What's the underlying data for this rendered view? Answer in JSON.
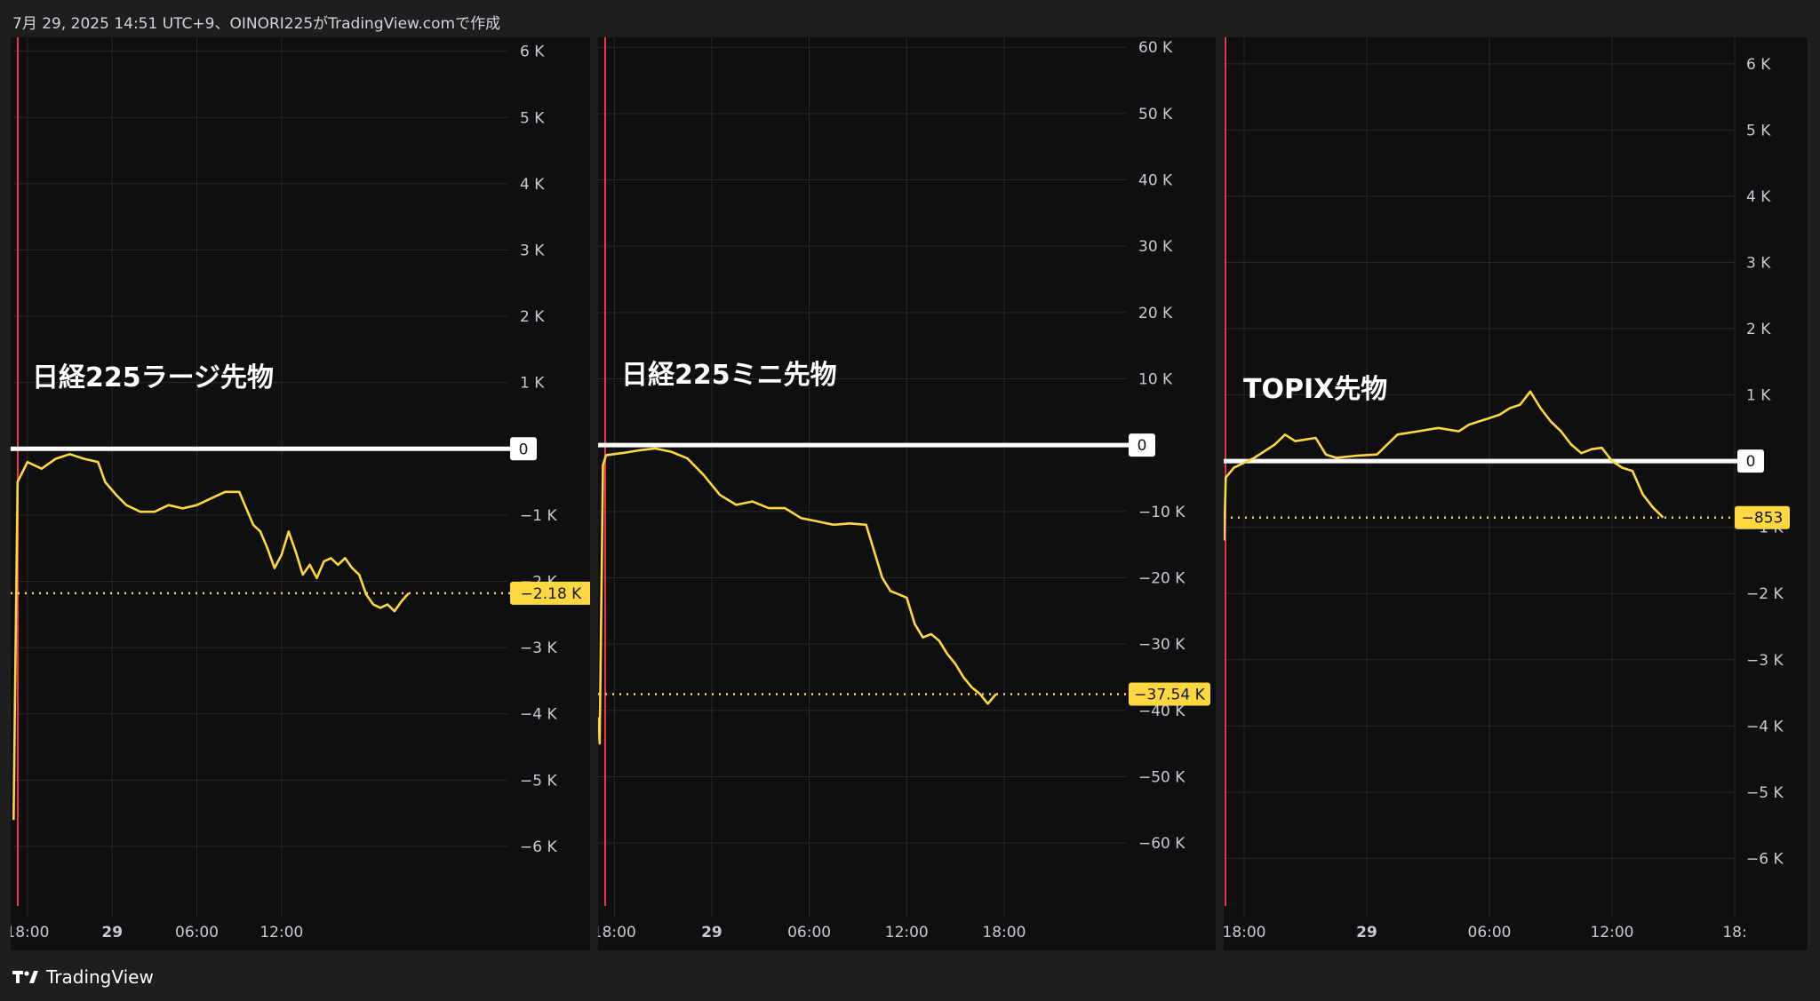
{
  "header": {
    "text": "7月 29, 2025 14:51 UTC+9、OINORI225がTradingView.comで作成"
  },
  "footer": {
    "brand": "TradingView",
    "logo_icon": "tradingview-logo-icon"
  },
  "colors": {
    "background": "#1e1e1e",
    "panel": "#0f0f0f",
    "series": "#ffd740",
    "zero_line": "#ffffff",
    "session_marker": "#f23645",
    "grid": "#2a2a2a"
  },
  "chart_data": [
    {
      "type": "line",
      "title": "日経225ラージ先物",
      "y_ticks": [
        6000,
        5000,
        4000,
        3000,
        2000,
        1000,
        0,
        -1000,
        -2000,
        -3000,
        -4000,
        -5000,
        -6000
      ],
      "y_tick_labels": [
        "6 K",
        "5 K",
        "4 K",
        "3 K",
        "2 K",
        "1 K",
        "",
        "−1 K",
        "−2 K",
        "−3 K",
        "−4 K",
        "−5 K",
        "−6 K"
      ],
      "ylim": [
        -7060,
        6210
      ],
      "x_ticks": [
        {
          "x": 0.5,
          "label": "18:00",
          "bold": false
        },
        {
          "x": 6.5,
          "label": "29",
          "bold": true
        },
        {
          "x": 12.5,
          "label": "06:00",
          "bold": false
        },
        {
          "x": 18.5,
          "label": "12:00",
          "bold": false
        }
      ],
      "xlim": [
        -0.5,
        34.5
      ],
      "zero_label": "0",
      "last_value": -2180,
      "last_label": "−2.18 K",
      "series": [
        {
          "values": [
            [
              -0.48,
              -5600
            ],
            [
              -0.35,
              -3200
            ],
            [
              -0.2,
              -500
            ],
            [
              0.5,
              -200
            ],
            [
              1.5,
              -300
            ],
            [
              2.5,
              -150
            ],
            [
              3.5,
              -80
            ],
            [
              4.5,
              -150
            ],
            [
              5.5,
              -200
            ],
            [
              6.0,
              -500
            ],
            [
              6.8,
              -700
            ],
            [
              7.5,
              -850
            ],
            [
              8.5,
              -950
            ],
            [
              9.5,
              -950
            ],
            [
              10.5,
              -850
            ],
            [
              11.5,
              -900
            ],
            [
              12.5,
              -850
            ],
            [
              13.5,
              -750
            ],
            [
              14.5,
              -650
            ],
            [
              15.5,
              -650
            ],
            [
              16.0,
              -900
            ],
            [
              16.5,
              -1150
            ],
            [
              17.0,
              -1250
            ],
            [
              17.5,
              -1500
            ],
            [
              18.0,
              -1800
            ],
            [
              18.5,
              -1600
            ],
            [
              19.0,
              -1250
            ],
            [
              19.5,
              -1550
            ],
            [
              20.0,
              -1900
            ],
            [
              20.5,
              -1750
            ],
            [
              21.0,
              -1950
            ],
            [
              21.5,
              -1700
            ],
            [
              22.0,
              -1650
            ],
            [
              22.5,
              -1750
            ],
            [
              23.0,
              -1650
            ],
            [
              23.5,
              -1800
            ],
            [
              24.0,
              -1900
            ],
            [
              24.5,
              -2200
            ],
            [
              25.0,
              -2350
            ],
            [
              25.5,
              -2400
            ],
            [
              26.0,
              -2350
            ],
            [
              26.5,
              -2450
            ],
            [
              27.0,
              -2300
            ],
            [
              27.5,
              -2180
            ]
          ]
        }
      ]
    },
    {
      "type": "line",
      "title": "日経225ミニ先物",
      "y_ticks": [
        60000,
        50000,
        40000,
        30000,
        20000,
        10000,
        0,
        -10000,
        -20000,
        -30000,
        -40000,
        -50000,
        -60000
      ],
      "y_tick_labels": [
        "60 K",
        "50 K",
        "40 K",
        "30 K",
        "20 K",
        "10 K",
        "",
        "−10 K",
        "−20 K",
        "−30 K",
        "−40 K",
        "−50 K",
        "−60 K"
      ],
      "ylim": [
        -71100,
        61500
      ],
      "x_ticks": [
        {
          "x": 0.5,
          "label": "18:00",
          "bold": false
        },
        {
          "x": 6.5,
          "label": "29",
          "bold": true
        },
        {
          "x": 12.5,
          "label": "06:00",
          "bold": false
        },
        {
          "x": 18.5,
          "label": "12:00",
          "bold": false
        },
        {
          "x": 24.5,
          "label": "18:00",
          "bold": false
        }
      ],
      "xlim": [
        -0.5,
        32.0
      ],
      "zero_label": "0",
      "last_value": -37540,
      "last_label": "−37.54 K",
      "series": [
        {
          "values": [
            [
              -0.47,
              -41000
            ],
            [
              -0.4,
              -45000
            ],
            [
              -0.2,
              -3000
            ],
            [
              0.0,
              -1500
            ],
            [
              1.0,
              -1200
            ],
            [
              2.0,
              -800
            ],
            [
              3.0,
              -500
            ],
            [
              4.0,
              -1000
            ],
            [
              5.0,
              -2000
            ],
            [
              6.0,
              -4500
            ],
            [
              7.0,
              -7500
            ],
            [
              8.0,
              -9000
            ],
            [
              9.0,
              -8500
            ],
            [
              10.0,
              -9500
            ],
            [
              11.0,
              -9500
            ],
            [
              12.0,
              -11000
            ],
            [
              13.0,
              -11500
            ],
            [
              14.0,
              -12000
            ],
            [
              15.0,
              -11800
            ],
            [
              16.0,
              -12000
            ],
            [
              16.5,
              -16000
            ],
            [
              17.0,
              -20000
            ],
            [
              17.5,
              -22000
            ],
            [
              18.0,
              -22500
            ],
            [
              18.5,
              -23000
            ],
            [
              19.0,
              -27000
            ],
            [
              19.5,
              -29000
            ],
            [
              20.0,
              -28500
            ],
            [
              20.5,
              -29500
            ],
            [
              21.0,
              -31500
            ],
            [
              21.5,
              -33000
            ],
            [
              22.0,
              -35000
            ],
            [
              22.5,
              -36500
            ],
            [
              23.0,
              -37500
            ],
            [
              23.5,
              -39000
            ],
            [
              24.0,
              -37540
            ]
          ]
        }
      ]
    },
    {
      "type": "line",
      "title": "TOPIX先物",
      "y_ticks": [
        6000,
        5000,
        4000,
        3000,
        2000,
        1000,
        0,
        -1000,
        -2000,
        -3000,
        -4000,
        -5000,
        -6000
      ],
      "y_tick_labels": [
        "6 K",
        "5 K",
        "4 K",
        "3 K",
        "2 K",
        "1 K",
        "",
        "−1 K",
        "−2 K",
        "−3 K",
        "−4 K",
        "−5 K",
        "−6 K"
      ],
      "ylim": [
        -6880,
        6400
      ],
      "x_ticks": [
        {
          "x": 0.5,
          "label": "18:00",
          "bold": false
        },
        {
          "x": 6.5,
          "label": "29",
          "bold": true
        },
        {
          "x": 12.5,
          "label": "06:00",
          "bold": false
        },
        {
          "x": 18.5,
          "label": "12:00",
          "bold": false
        },
        {
          "x": 24.5,
          "label": "18:",
          "bold": false
        }
      ],
      "xlim": [
        -0.5,
        24.5
      ],
      "zero_label": "0",
      "last_value": -853,
      "last_label": "−853",
      "series": [
        {
          "values": [
            [
              -0.48,
              -1200
            ],
            [
              -0.4,
              -250
            ],
            [
              0.0,
              -100
            ],
            [
              1.0,
              50
            ],
            [
              2.0,
              250
            ],
            [
              2.5,
              400
            ],
            [
              3.0,
              300
            ],
            [
              4.0,
              350
            ],
            [
              4.5,
              100
            ],
            [
              5.0,
              50
            ],
            [
              6.0,
              80
            ],
            [
              7.0,
              100
            ],
            [
              7.5,
              250
            ],
            [
              8.0,
              400
            ],
            [
              9.0,
              450
            ],
            [
              10.0,
              500
            ],
            [
              11.0,
              450
            ],
            [
              11.5,
              550
            ],
            [
              12.0,
              600
            ],
            [
              12.5,
              650
            ],
            [
              13.0,
              700
            ],
            [
              13.5,
              800
            ],
            [
              14.0,
              850
            ],
            [
              14.5,
              1050
            ],
            [
              15.0,
              800
            ],
            [
              15.5,
              600
            ],
            [
              16.0,
              450
            ],
            [
              16.5,
              250
            ],
            [
              17.0,
              120
            ],
            [
              17.5,
              180
            ],
            [
              18.0,
              200
            ],
            [
              18.5,
              0
            ],
            [
              19.0,
              -100
            ],
            [
              19.5,
              -150
            ],
            [
              20.0,
              -500
            ],
            [
              20.5,
              -700
            ],
            [
              21.0,
              -853
            ]
          ]
        }
      ]
    }
  ]
}
